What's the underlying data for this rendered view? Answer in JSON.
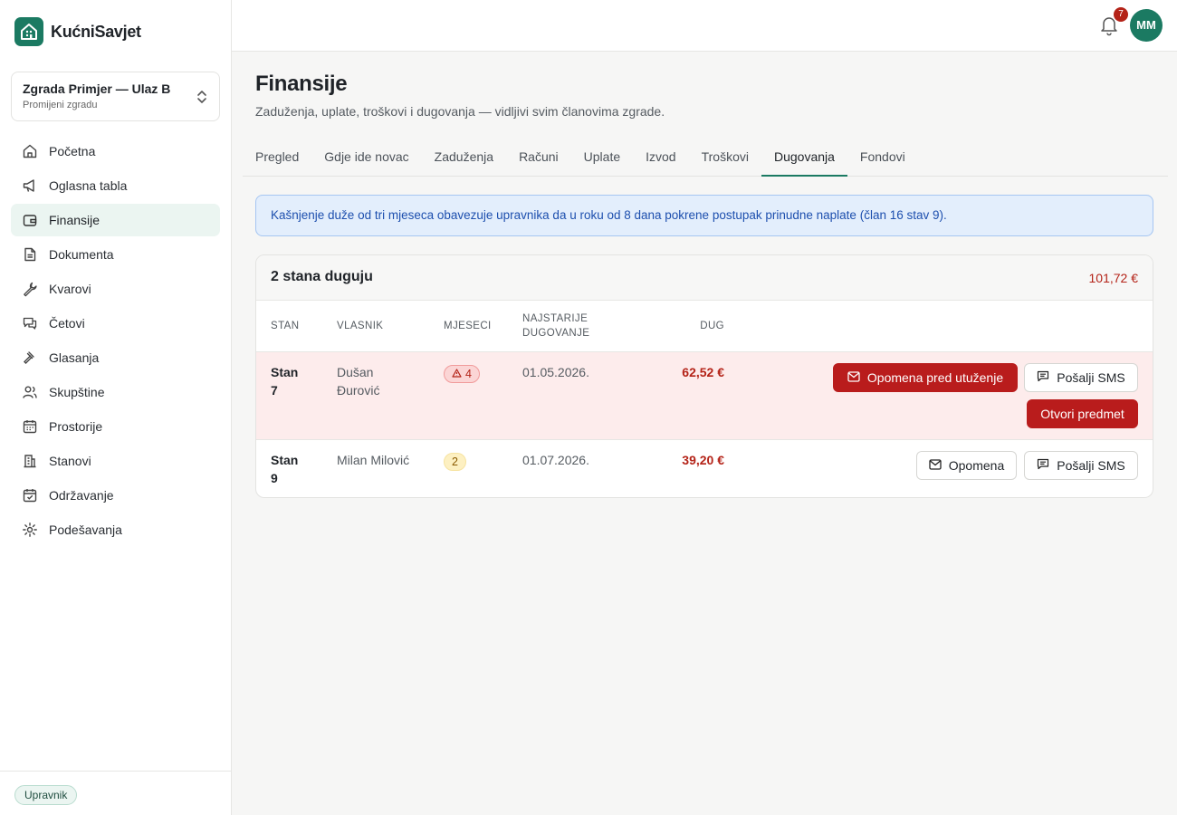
{
  "brand": {
    "name": "KućniSavjet"
  },
  "building": {
    "name": "Zgrada Primjer — Ulaz B",
    "action": "Promijeni zgradu"
  },
  "nav": [
    {
      "label": "Početna",
      "icon": "home-icon"
    },
    {
      "label": "Oglasna tabla",
      "icon": "megaphone-icon"
    },
    {
      "label": "Finansije",
      "icon": "wallet-icon",
      "active": true
    },
    {
      "label": "Dokumenta",
      "icon": "document-icon"
    },
    {
      "label": "Kvarovi",
      "icon": "wrench-icon"
    },
    {
      "label": "Četovi",
      "icon": "chat-icon"
    },
    {
      "label": "Glasanja",
      "icon": "gavel-icon"
    },
    {
      "label": "Skupštine",
      "icon": "users-icon"
    },
    {
      "label": "Prostorije",
      "icon": "calendar-icon"
    },
    {
      "label": "Stanovi",
      "icon": "building-icon"
    },
    {
      "label": "Održavanje",
      "icon": "calendar-check-icon"
    },
    {
      "label": "Podešavanja",
      "icon": "gear-icon"
    }
  ],
  "role": "Upravnik",
  "topbar": {
    "notifications": "7",
    "avatar_initials": "MM"
  },
  "page": {
    "title": "Finansije",
    "subtitle": "Zaduženja, uplate, troškovi i dugovanja — vidljivi svim članovima zgrade."
  },
  "tabs": [
    "Pregled",
    "Gdje ide novac",
    "Zaduženja",
    "Računi",
    "Uplate",
    "Izvod",
    "Troškovi",
    "Dugovanja",
    "Fondovi"
  ],
  "active_tab": "Dugovanja",
  "alert": "Kašnjenje duže od tri mjeseca obavezuje upravnika da u roku od 8 dana pokrene postupak prinudne naplate (član 16 stav 9).",
  "debts": {
    "title": "2 stana duguju",
    "total": "101,72 €",
    "columns": {
      "stan": "Stan",
      "vlasnik": "Vlasnik",
      "mjeseci": "Mjeseci",
      "najstarije_1": "Najstarije",
      "najstarije_2": "dugovanje",
      "dug": "Dug"
    },
    "rows": [
      {
        "stan": "Stan 7",
        "owner": "Dušan Đurović",
        "months": "4",
        "oldest": "01.05.2026.",
        "debt": "62,52 €",
        "actions": {
          "warning": "Opomena pred utuženje",
          "sms": "Pošalji SMS",
          "case": "Otvori predmet"
        }
      },
      {
        "stan": "Stan 9",
        "owner": "Milan Milović",
        "months": "2",
        "oldest": "01.07.2026.",
        "debt": "39,20 €",
        "actions": {
          "warning": "Opomena",
          "sms": "Pošalji SMS"
        }
      }
    ]
  },
  "colors": {
    "brand": "#1b7a62",
    "danger": "#b91c1c",
    "info_bg": "#e3eefc",
    "row_alert_bg": "#fdecec"
  }
}
